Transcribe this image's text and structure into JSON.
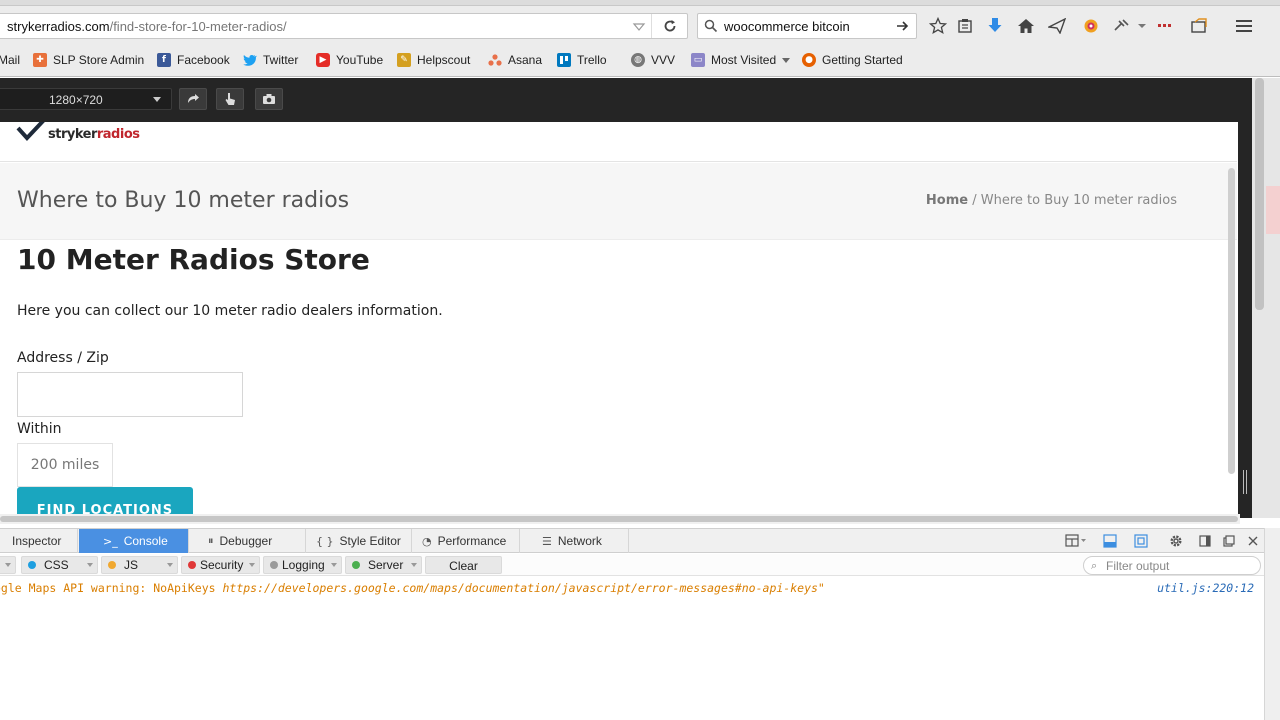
{
  "browser": {
    "url_host": "strykerradios.com",
    "url_path": "/find-store-for-10-meter-radios/",
    "search_value": "woocommerce bitcoin",
    "bookmarks": [
      {
        "label": "Mail",
        "icon": "mail-icon"
      },
      {
        "label": "SLP Store Admin",
        "icon": "slp-icon"
      },
      {
        "label": "Facebook",
        "icon": "facebook-icon"
      },
      {
        "label": "Twitter",
        "icon": "twitter-icon"
      },
      {
        "label": "YouTube",
        "icon": "youtube-icon"
      },
      {
        "label": "Helpscout",
        "icon": "helpscout-icon"
      },
      {
        "label": "Asana",
        "icon": "asana-icon"
      },
      {
        "label": "Trello",
        "icon": "trello-icon"
      },
      {
        "label": "VVV",
        "icon": "globe-icon"
      },
      {
        "label": "Most Visited",
        "icon": "folder-icon"
      },
      {
        "label": "Getting Started",
        "icon": "firefox-icon"
      }
    ]
  },
  "responsive": {
    "preset": "1280×720"
  },
  "page": {
    "logo_part1": "stryker",
    "logo_part2": "radios",
    "title": "Where to Buy 10 meter radios",
    "breadcrumb_home": "Home",
    "breadcrumb_sep": " / ",
    "breadcrumb_current": "Where to Buy 10 meter radios",
    "heading": "10 Meter Radios Store",
    "intro": "Here you can collect our 10 meter radio dealers information.",
    "address_label": "Address / Zip",
    "address_value": "",
    "within_label": "Within",
    "within_value": "200 miles",
    "find_button": "FIND LOCATIONS"
  },
  "devtools": {
    "tabs": [
      {
        "label": "Inspector",
        "icon": "inspector-icon"
      },
      {
        "label": "Console",
        "icon": "console-icon",
        "active": true
      },
      {
        "label": "Debugger",
        "icon": "debugger-icon"
      },
      {
        "label": "Style Editor",
        "icon": "style-editor-icon"
      },
      {
        "label": "Performance",
        "icon": "performance-icon"
      },
      {
        "label": "Network",
        "icon": "network-icon"
      }
    ],
    "filters": {
      "css": "CSS",
      "js": "JS",
      "security": "Security",
      "logging": "Logging",
      "server": "Server",
      "clear": "Clear",
      "filter_placeholder": "Filter output"
    },
    "console_message_prefix": "ogle Maps API warning: NoApiKeys ",
    "console_message_link": "https://developers.google.com/maps/documentation/javascript/error-messages#no-api-keys\"",
    "console_location": "util.js:220:12"
  },
  "colors": {
    "brand_red": "#c0262d",
    "find_button": "#1aa6bf",
    "active_tab": "#4a90e2",
    "warning_text": "#d97e00",
    "css_dot": "#1e9fe0",
    "js_dot": "#f0a830",
    "security_dot": "#e03838",
    "logging_dot": "#9a9a9a",
    "server_dot": "#4caf50"
  }
}
